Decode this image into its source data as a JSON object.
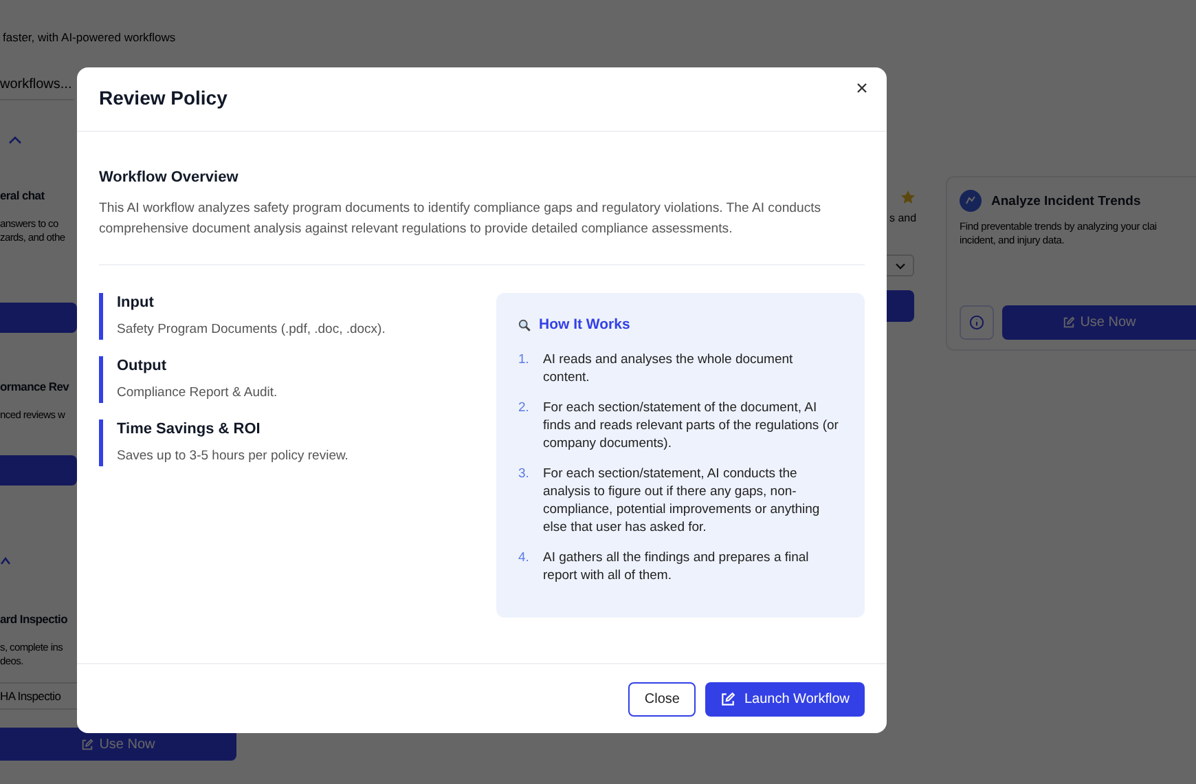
{
  "background": {
    "subtitle": "faster, with AI-powered workflows",
    "search": {
      "value": "workflows..."
    },
    "left_cards": [
      {
        "title": "eral chat",
        "lines": [
          "answers to co",
          "zards, and othe"
        ]
      },
      {
        "title": "ormance Rev",
        "lines": [
          "nced reviews w"
        ]
      },
      {
        "title": "ard Inspectio",
        "lines": [
          "s, complete ins",
          "deos."
        ],
        "select": "HA Inspectio",
        "button": "Use Now"
      }
    ],
    "right_fragment": {
      "text": "s and"
    },
    "right_card": {
      "title": "Analyze Incident Trends",
      "lines": [
        "Find preventable trends by analyzing your clai",
        "incident, and injury data."
      ],
      "button": "Use Now"
    }
  },
  "modal": {
    "title": "Review Policy",
    "overview": {
      "heading": "Workflow Overview",
      "text": "This AI workflow analyzes safety program documents to identify compliance gaps and regulatory violations. The AI conducts comprehensive document analysis against relevant regulations to provide detailed compliance assessments."
    },
    "details": [
      {
        "title": "Input",
        "text": "Safety Program Documents (.pdf, .doc, .docx)."
      },
      {
        "title": "Output",
        "text": "Compliance Report & Audit."
      },
      {
        "title": "Time Savings & ROI",
        "text": "Saves up to 3-5 hours per policy review."
      }
    ],
    "how_it_works": {
      "title": "How It Works",
      "steps": [
        {
          "number": "1.",
          "text": "AI reads and analyses the whole document content."
        },
        {
          "number": "2.",
          "text": "For each section/statement of the document, AI finds and reads relevant parts of the regulations (or company documents)."
        },
        {
          "number": "3.",
          "text": "For each section/statement, AI conducts the analysis to figure out if there any gaps, non-compliance, potential improvements or anything else that user has asked for."
        },
        {
          "number": "4.",
          "text": "AI gathers all the findings and prepares a final report with all of them."
        }
      ]
    },
    "buttons": {
      "close": "Close",
      "launch": "Launch Workflow"
    }
  }
}
